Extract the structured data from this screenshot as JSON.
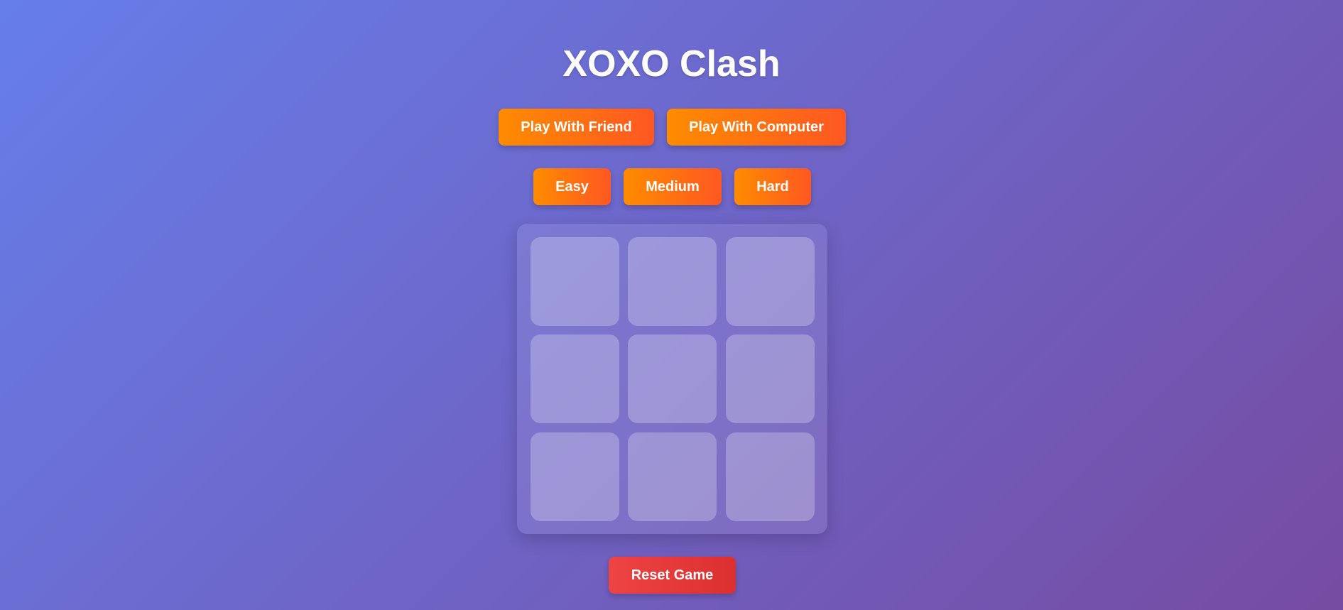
{
  "title": "XOXO Clash",
  "modes": {
    "friend_label": "Play With Friend",
    "computer_label": "Play With Computer"
  },
  "difficulty": {
    "easy_label": "Easy",
    "medium_label": "Medium",
    "hard_label": "Hard"
  },
  "board": {
    "cells": [
      "",
      "",
      "",
      "",
      "",
      "",
      "",
      "",
      ""
    ]
  },
  "reset_label": "Reset Game",
  "colors": {
    "background_start": "#667eea",
    "background_end": "#764ba2",
    "button_orange_start": "#ff8c00",
    "button_orange_end": "#ff5722",
    "reset_red": "#ef4444"
  }
}
